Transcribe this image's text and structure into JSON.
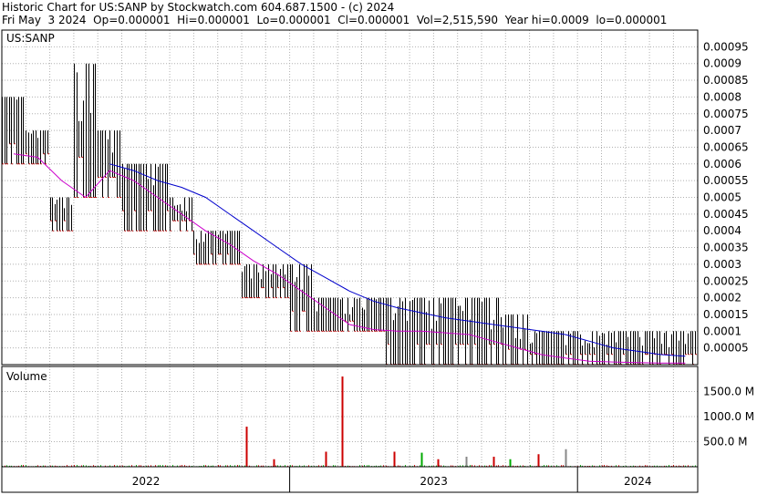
{
  "header": {
    "title_line": "Historic Chart for US:SANP by Stockwatch.com 604.687.1500 - (c) 2024",
    "quote_line": "Fri May  3 2024  Op=0.000001  Hi=0.000001  Lo=0.000001  Cl=0.000001  Vol=2,515,590  Year hi=0.0009  lo=0.000001"
  },
  "colors": {
    "background": "#ffffff",
    "grid": "#b0b0b0",
    "price_bar": "#000000",
    "close_tick": "#cc0000",
    "ma_short": "#cc00cc",
    "ma_long": "#0000cc",
    "volume_up": "#00aa00",
    "volume_down": "#cc0000",
    "volume_flat": "#888888"
  },
  "chart_data": [
    {
      "type": "ohlc",
      "panel": "price",
      "symbol_label": "US:SANP",
      "ylim": [
        0,
        0.001
      ],
      "y_ticks": [
        "0.00095",
        "0.0009",
        "0.00085",
        "0.0008",
        "0.00075",
        "0.0007",
        "0.00065",
        "0.0006",
        "0.00055",
        "0.0005",
        "0.00045",
        "0.0004",
        "0.00035",
        "0.0003",
        "0.00025",
        "0.0002",
        "0.00015",
        "0.0001",
        "0.00005"
      ],
      "x_ticks": [
        "2022",
        "2023",
        "2024"
      ],
      "grid": true,
      "series": [
        {
          "kind": "price_range",
          "x": [
            "2022-01",
            "2022-02",
            "2022-03",
            "2022-04",
            "2022-05",
            "2022-06",
            "2022-07",
            "2022-08",
            "2022-09",
            "2022-10",
            "2022-11",
            "2022-12",
            "2023-01",
            "2023-02",
            "2023-03",
            "2023-04",
            "2023-05",
            "2023-06",
            "2023-07",
            "2023-08",
            "2023-09",
            "2023-10",
            "2023-11",
            "2023-12",
            "2024-01",
            "2024-02",
            "2024-03",
            "2024-04",
            "2024-05"
          ],
          "high": [
            0.0008,
            0.0007,
            0.0005,
            0.0009,
            0.0007,
            0.0006,
            0.0006,
            0.0005,
            0.0004,
            0.0004,
            0.0003,
            0.0003,
            0.0003,
            0.0002,
            0.0002,
            0.0002,
            0.0002,
            0.0002,
            0.0002,
            0.0002,
            0.0002,
            0.00015,
            0.0001,
            0.0001,
            0.0001,
            0.0001,
            0.0001,
            0.0001,
            0.0001
          ],
          "low": [
            0.0006,
            0.0006,
            0.0004,
            0.0005,
            0.0005,
            0.0004,
            0.0004,
            0.0004,
            0.0003,
            0.0003,
            0.0002,
            0.0002,
            0.0001,
            0.0001,
            0.0001,
            0.0001,
            1e-06,
            1e-06,
            1e-06,
            1e-06,
            1e-06,
            1e-06,
            1e-06,
            1e-06,
            1e-06,
            1e-06,
            1e-06,
            1e-06,
            1e-06
          ]
        },
        {
          "kind": "ma_short",
          "y": [
            0.00063,
            0.00062,
            0.00055,
            0.0005,
            0.00058,
            0.00055,
            0.0005,
            0.00045,
            0.0004,
            0.00036,
            0.00031,
            0.00027,
            0.00022,
            0.00017,
            0.00012,
            0.000105,
            0.0001,
            0.0001,
            9.5e-05,
            9e-05,
            7e-05,
            5e-05,
            3e-05,
            2e-05,
            1e-05,
            8e-06,
            6e-06,
            5e-06,
            5e-06
          ]
        },
        {
          "kind": "ma_long",
          "y": [
            null,
            null,
            null,
            null,
            0.0006,
            0.00058,
            0.00055,
            0.00053,
            0.0005,
            0.00045,
            0.0004,
            0.00035,
            0.0003,
            0.00026,
            0.00022,
            0.00019,
            0.00017,
            0.000155,
            0.00014,
            0.00013,
            0.00012,
            0.00011,
            0.0001,
            9e-05,
            7e-05,
            5e-05,
            4e-05,
            3e-05,
            2.5e-05
          ]
        }
      ]
    },
    {
      "type": "bar",
      "panel": "volume",
      "title": "Volume",
      "ylim": [
        0,
        2000
      ],
      "unit": "M",
      "y_ticks": [
        "1500.0 M",
        "1000.0 M",
        "500.0 M"
      ],
      "x_ticks": [
        "2022",
        "2023",
        "2024"
      ],
      "spikes": [
        {
          "x": "2022-11",
          "value": 800,
          "dir": "down"
        },
        {
          "x": "2022-12",
          "value": 150,
          "dir": "down"
        },
        {
          "x": "2023-02",
          "value": 300,
          "dir": "down"
        },
        {
          "x": "2023-03",
          "value": 1800,
          "dir": "down"
        },
        {
          "x": "2023-05",
          "value": 300,
          "dir": "down"
        },
        {
          "x": "2023-06",
          "value": 280,
          "dir": "up"
        },
        {
          "x": "2023-07",
          "value": 150,
          "dir": "down"
        },
        {
          "x": "2023-08",
          "value": 200,
          "dir": "flat"
        },
        {
          "x": "2023-09",
          "value": 200,
          "dir": "down"
        },
        {
          "x": "2023-10",
          "value": 150,
          "dir": "up"
        },
        {
          "x": "2023-11",
          "value": 250,
          "dir": "down"
        },
        {
          "x": "2023-12",
          "value": 350,
          "dir": "flat"
        }
      ]
    }
  ]
}
